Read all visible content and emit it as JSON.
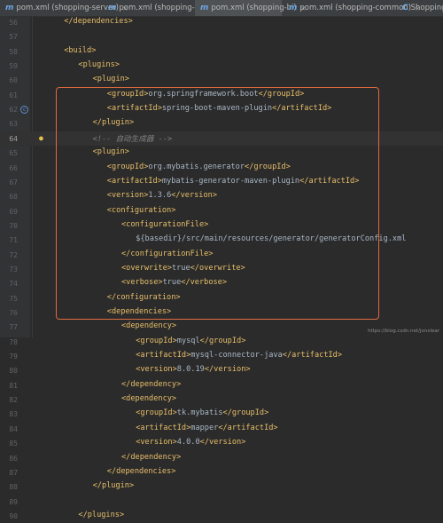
{
  "tabs": [
    {
      "icon": "m",
      "label": "pom.xml (shopping-server)",
      "active": false
    },
    {
      "icon": "m",
      "label": "pom.xml (shopping-api)",
      "active": false
    },
    {
      "icon": "m",
      "label": "pom.xml (shopping-bi)",
      "active": true
    },
    {
      "icon": "m",
      "label": "pom.xml (shopping-common)",
      "active": false
    },
    {
      "icon": "C",
      "label": "ShoppingA",
      "active": false
    }
  ],
  "editor": {
    "lines": [
      {
        "n": "56",
        "indent": 4,
        "html": "<span class='tg'>&lt;/dependencies&gt;</span>"
      },
      {
        "n": "57",
        "indent": 0,
        "html": ""
      },
      {
        "n": "58",
        "indent": 4,
        "html": "<span class='tg'>&lt;build&gt;</span>"
      },
      {
        "n": "59",
        "indent": 8,
        "html": "<span class='tg'>&lt;plugins&gt;</span>"
      },
      {
        "n": "60",
        "indent": 12,
        "html": "<span class='tg'>&lt;plugin&gt;</span>"
      },
      {
        "n": "61",
        "indent": 16,
        "html": "<span class='tg'>&lt;groupId&gt;</span>org.springframework.boot<span class='tg'>&lt;/groupId&gt;</span>"
      },
      {
        "n": "62",
        "indent": 16,
        "html": "<span class='tg'>&lt;artifactId&gt;</span>spring-boot-maven-plugin<span class='tg'>&lt;/artifactId&gt;</span>"
      },
      {
        "n": "63",
        "indent": 12,
        "html": "<span class='tg'>&lt;/plugin&gt;</span>"
      },
      {
        "n": "64",
        "indent": 12,
        "html": "<span class='cm'>&lt;!-- 自动生成器 --&gt;</span>"
      },
      {
        "n": "65",
        "indent": 12,
        "html": "<span class='tg'>&lt;plugin&gt;</span>"
      },
      {
        "n": "66",
        "indent": 16,
        "html": "<span class='tg'>&lt;groupId&gt;</span>org.mybatis.generator<span class='tg'>&lt;/groupId&gt;</span>"
      },
      {
        "n": "67",
        "indent": 16,
        "html": "<span class='tg'>&lt;artifactId&gt;</span>mybatis-generator-maven-plugin<span class='tg'>&lt;/artifactId&gt;</span>"
      },
      {
        "n": "68",
        "indent": 16,
        "html": "<span class='tg'>&lt;version&gt;</span>1.3.6<span class='tg'>&lt;/version&gt;</span>"
      },
      {
        "n": "69",
        "indent": 16,
        "html": "<span class='tg'>&lt;configuration&gt;</span>"
      },
      {
        "n": "70",
        "indent": 20,
        "html": "<span class='tg'>&lt;configurationFile&gt;</span>"
      },
      {
        "n": "71",
        "indent": 24,
        "html": "${basedir}/src/main/resources/generator/generatorConfig.xml"
      },
      {
        "n": "72",
        "indent": 20,
        "html": "<span class='tg'>&lt;/configurationFile&gt;</span>"
      },
      {
        "n": "73",
        "indent": 20,
        "html": "<span class='tg'>&lt;overwrite&gt;</span>true<span class='tg'>&lt;/overwrite&gt;</span>"
      },
      {
        "n": "74",
        "indent": 20,
        "html": "<span class='tg'>&lt;verbose&gt;</span>true<span class='tg'>&lt;/verbose&gt;</span>"
      },
      {
        "n": "75",
        "indent": 16,
        "html": "<span class='tg'>&lt;/configuration&gt;</span>"
      },
      {
        "n": "76",
        "indent": 16,
        "html": "<span class='tg'>&lt;dependencies&gt;</span>"
      },
      {
        "n": "77",
        "indent": 20,
        "html": "<span class='tg'>&lt;dependency&gt;</span>"
      },
      {
        "n": "78",
        "indent": 24,
        "html": "<span class='tg'>&lt;groupId&gt;</span>mysql<span class='tg'>&lt;/groupId&gt;</span>"
      },
      {
        "n": "79",
        "indent": 24,
        "html": "<span class='tg'>&lt;artifactId&gt;</span>mysql-connector-java<span class='tg'>&lt;/artifactId&gt;</span>"
      },
      {
        "n": "80",
        "indent": 24,
        "html": "<span class='tg'>&lt;version&gt;</span>8.0.19<span class='tg'>&lt;/version&gt;</span>"
      },
      {
        "n": "81",
        "indent": 20,
        "html": "<span class='tg'>&lt;/dependency&gt;</span>"
      },
      {
        "n": "82",
        "indent": 20,
        "html": "<span class='tg'>&lt;dependency&gt;</span>"
      },
      {
        "n": "83",
        "indent": 24,
        "html": "<span class='tg'>&lt;groupId&gt;</span>tk.mybatis<span class='tg'>&lt;/groupId&gt;</span>"
      },
      {
        "n": "84",
        "indent": 24,
        "html": "<span class='tg'>&lt;artifactId&gt;</span>mapper<span class='tg'>&lt;/artifactId&gt;</span>"
      },
      {
        "n": "85",
        "indent": 24,
        "html": "<span class='tg'>&lt;version&gt;</span>4.0.0<span class='tg'>&lt;/version&gt;</span>"
      },
      {
        "n": "86",
        "indent": 20,
        "html": "<span class='tg'>&lt;/dependency&gt;</span>"
      },
      {
        "n": "87",
        "indent": 16,
        "html": "<span class='tg'>&lt;/dependencies&gt;</span>"
      },
      {
        "n": "88",
        "indent": 12,
        "html": "<span class='tg'>&lt;/plugin&gt;</span>"
      },
      {
        "n": "89",
        "indent": 0,
        "html": ""
      },
      {
        "n": "90",
        "indent": 8,
        "html": "<span class='tg'>&lt;/plugins&gt;</span>"
      }
    ],
    "caret_line": "64",
    "gutter_icon_lines": [
      "62"
    ],
    "bulb_line": "64"
  },
  "watermark": "https://blog.csdn.net/jxnxlear"
}
